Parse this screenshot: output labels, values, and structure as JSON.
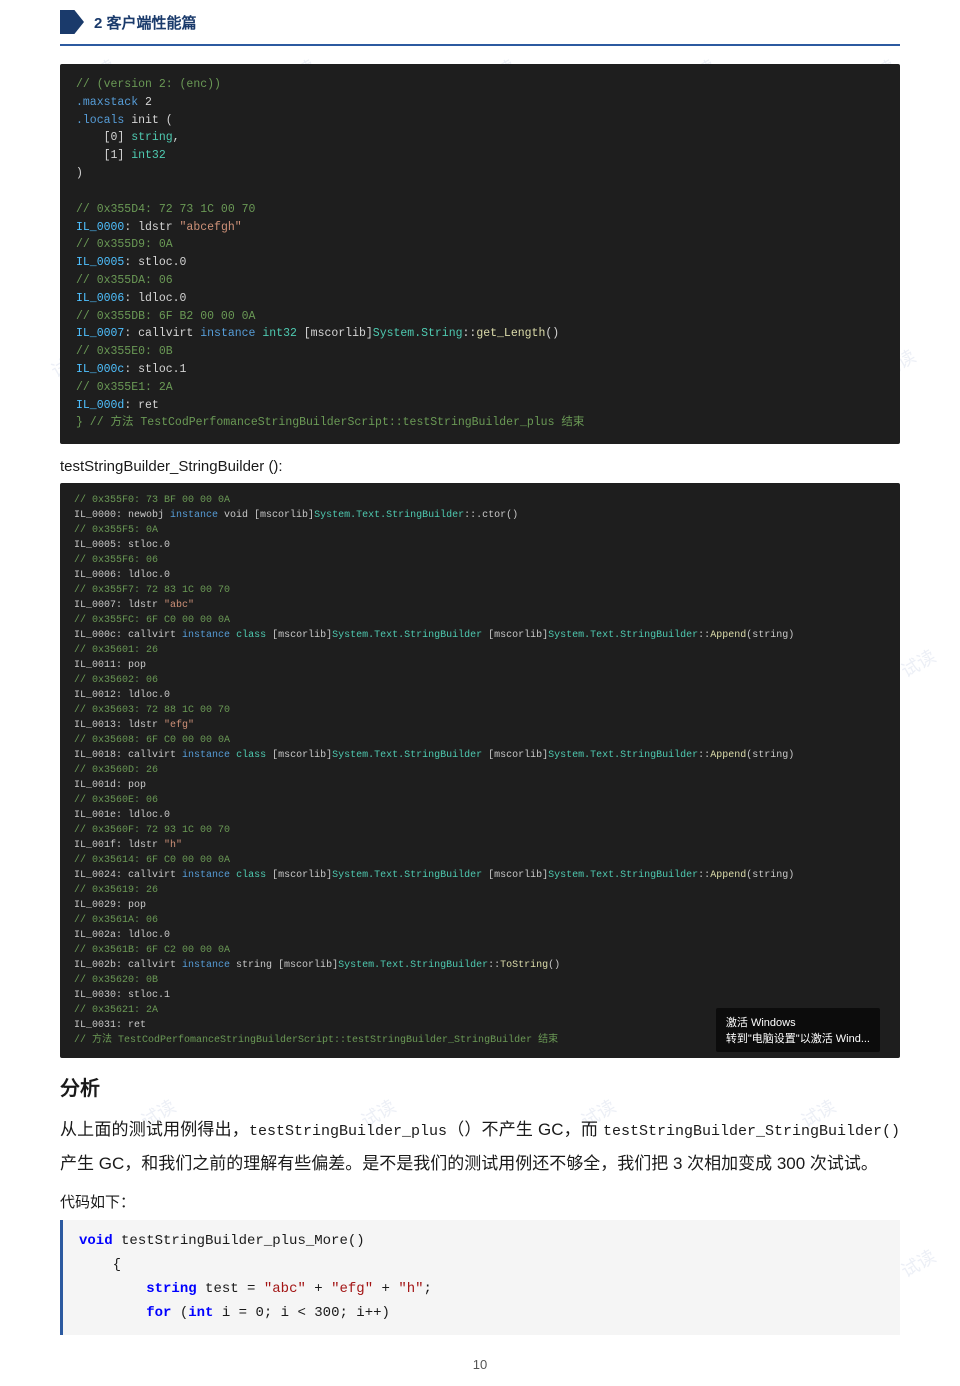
{
  "chapter": {
    "number": "2",
    "title": "2 客户端性能篇"
  },
  "code_block_1": {
    "lines": [
      "// (version 2: (enc))",
      ".maxstack 2",
      ".locals init (",
      "    [0] string,",
      "    [1] int32",
      ")",
      "",
      "// 0x355D4: 72 73 1C 00 70",
      "IL_0000: ldstr \"abcefgh\"",
      "// 0x355D9: 0A",
      "IL_0005: stloc.0",
      "// 0x355DA: 06",
      "IL_0006: ldloc.0",
      "// 0x355DB: 6F B2 00 00 0A",
      "IL_0007: callvirt instance int32 [mscorlib]System.String::get_Length()",
      "// 0x355E0: 0B",
      "IL_000c: stloc.1",
      "// 0x355E1: 2A",
      "IL_000d: ret",
      "} // 方法 TestCodPerfomanceStringBuilderScript::testStringBuilder_plus 结束"
    ]
  },
  "function_title_1": "testStringBuilder_StringBuilder ():",
  "code_block_2": {
    "lines": [
      "// 0x355F0: 73 BF 00 00 0A",
      "IL_0000: newobj instance void [mscorlib]System.Text.StringBuilder::.ctor()",
      "// 0x355F5: 0A",
      "IL_0005: stloc.0",
      "// 0x355F6: 06",
      "IL_0006: ldloc.0",
      "// 0x355F7: 72 83 1C 00 70",
      "IL_0007: ldstr \"abc\"",
      "// 0x355FC: 6F C0 00 00 0A",
      "IL_000c: callvirt instance class [mscorlib]System.Text.StringBuilder [mscorlib]System.Text.StringBuilder::Append(string)",
      "// 0x35601: 26",
      "IL_0011: pop",
      "// 0x35602: 06",
      "IL_0012: ldloc.0",
      "// 0x35603: 72 88 1C 00 70",
      "IL_0013: ldstr \"efg\"",
      "// 0x35608: 6F C0 00 00 0A",
      "IL_0018: callvirt instance class [mscorlib]System.Text.StringBuilder [mscorlib]System.Text.StringBuilder::Append(string)",
      "// 0x3560D: 26",
      "IL_001d: pop",
      "// 0x3560E: 06",
      "IL_001e: ldloc.0",
      "// 0x3560F: 72 93 1C 00 70",
      "IL_001f: ldstr \"h\"",
      "// 0x35614: 6F C0 00 00 0A",
      "IL_0024: callvirt instance class [mscorlib]System.Text.StringBuilder [mscorlib]System.Text.StringBuilder::Append(string)",
      "// 0x35619: 26",
      "IL_0029: pop",
      "// 0x3561A: 06",
      "IL_002a: ldloc.0",
      "// 0x3561B: 6F C2 00 00 0A",
      "IL_002b: callvirt instance string [mscorlib]System.Text.StringBuilder::ToString()",
      "// 0x35620: 0B",
      "IL_0030: stloc.1",
      "// 0x35621: 2A",
      "IL_0031: ret",
      "// 方法 TestCodPerfomanceStringBuilderScript::testStringBuilder_StringBuilder 结束"
    ]
  },
  "section_analysis": "分析",
  "analysis_text": "从上面的测试用例得出，testStringBuilder_plus（）不产生 GC，而 testStringBuilder_StringBuilder()产生 GC，和我们之前的理解有些偏差。是不是我们的测试用例还不够全，我们把 3 次相加变成 300 次试试。",
  "label_code": "代码如下：",
  "code_block_3": {
    "lines": [
      "void testStringBuilder_plus_More()",
      "    {",
      "        string test = \"abc\" + \"efg\" + \"h\";",
      "        for (int i = 0; i < 300; i++)"
    ]
  },
  "page_number": "10",
  "win_activate": {
    "line1": "激活 Windows",
    "line2": "转到\"电脑设置\"以激活 Wind..."
  },
  "watermarks": [
    "试读",
    "试读",
    "试读",
    "试读",
    "试读",
    "试读",
    "试读",
    "试读",
    "试读",
    "试读",
    "试读",
    "试读",
    "试读",
    "试读",
    "试读",
    "试读",
    "试读",
    "试读",
    "试读",
    "试读",
    "试读",
    "试读",
    "试读",
    "试读"
  ]
}
